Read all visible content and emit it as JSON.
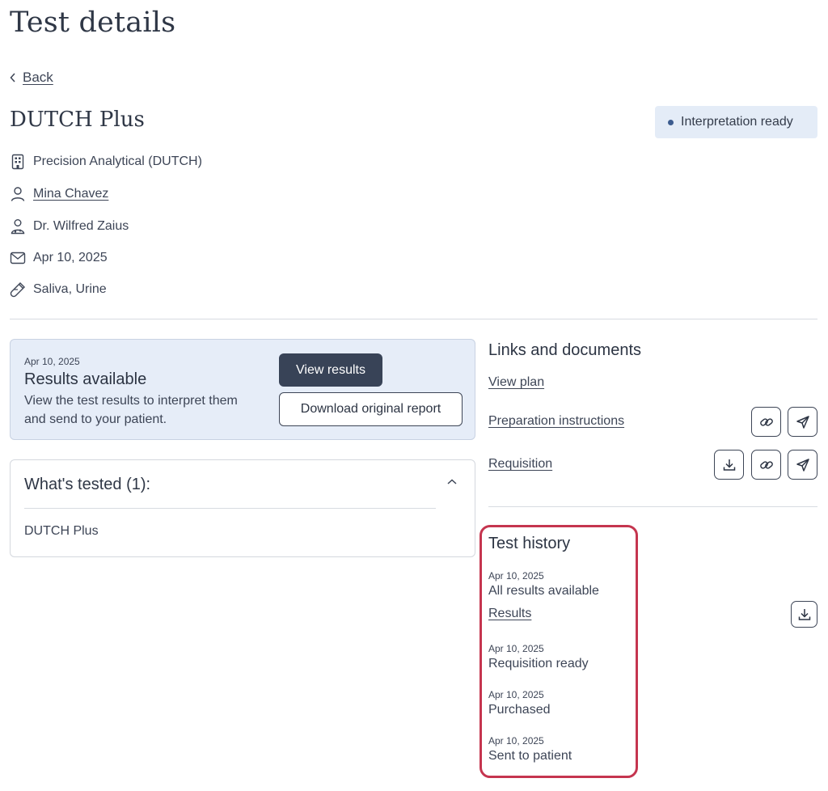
{
  "page": {
    "title": "Test details"
  },
  "nav": {
    "back_label": "Back"
  },
  "test": {
    "name": "DUTCH Plus",
    "status": "Interpretation ready",
    "lab": "Precision Analytical (DUTCH)",
    "patient": "Mina Chavez",
    "provider": "Dr. Wilfred Zaius",
    "date": "Apr 10, 2025",
    "sample_types": "Saliva, Urine"
  },
  "results_card": {
    "date": "Apr 10, 2025",
    "title": "Results available",
    "description": "View the test results to interpret them and send to your patient.",
    "view_button": "View results",
    "download_button": "Download original report"
  },
  "whats_tested": {
    "title": "What's tested (1):",
    "items": [
      "DUTCH Plus"
    ]
  },
  "links": {
    "heading": "Links and documents",
    "view_plan": "View plan",
    "preparation": "Preparation instructions",
    "requisition": "Requisition"
  },
  "history": {
    "heading": "Test history",
    "events": [
      {
        "date": "Apr 10, 2025",
        "label": "All results available",
        "link": "Results"
      },
      {
        "date": "Apr 10, 2025",
        "label": "Requisition ready"
      },
      {
        "date": "Apr 10, 2025",
        "label": "Purchased"
      },
      {
        "date": "Apr 10, 2025",
        "label": "Sent to patient"
      }
    ]
  },
  "colors": {
    "accent_dark": "#384357",
    "badge_bg": "#e4ecf7",
    "card_bg": "#e6edf8",
    "highlight": "#c5354f"
  }
}
